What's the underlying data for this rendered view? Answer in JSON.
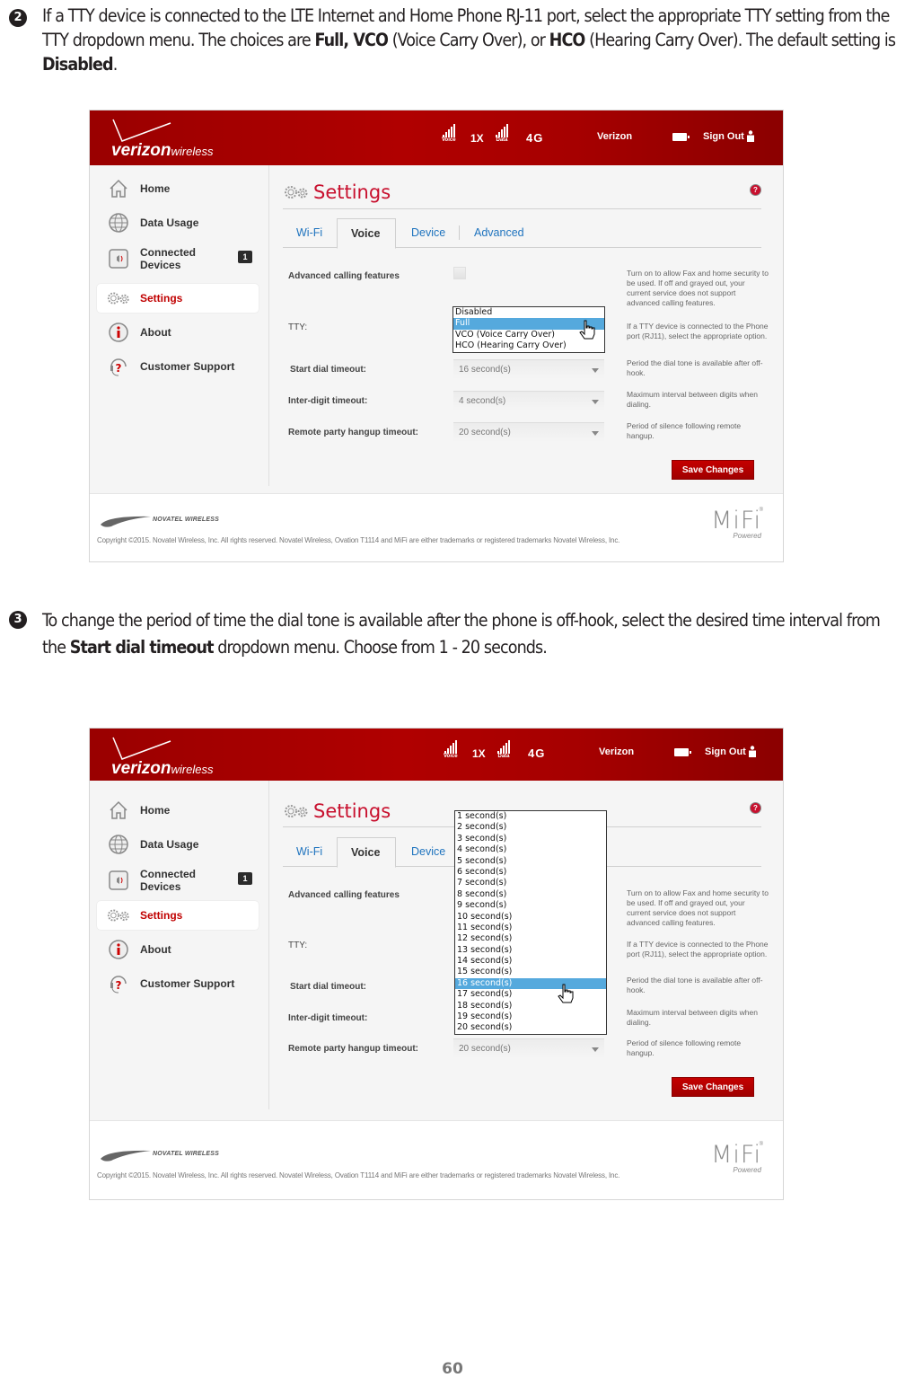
{
  "steps": [
    {
      "number": "2",
      "text_parts": {
        "p1": "If a TTY device is connected to the LTE Internet and Home Phone RJ-11 port, select the appropriate TTY setting from the TTY dropdown menu. The choices are ",
        "b1": "Full, VCO",
        "p2": " (Voice Carry Over), or ",
        "b2": "HCO",
        "p3": " (Hearing Carry Over). The default setting is ",
        "b3": "Disabled",
        "p4": "."
      }
    },
    {
      "number": "3",
      "text_parts": {
        "p1": "To change the period of time the dial tone is available after the phone is off-hook, select the desired time interval from the ",
        "b1": "Start dial timeout",
        "p2": " dropdown menu. Choose from 1 - 20 seconds."
      }
    }
  ],
  "app": {
    "brand_bold": "verizon",
    "brand_light": "wireless",
    "status": {
      "voice_label": "Voice",
      "network_1x": "1X",
      "data_label": "Data",
      "network_4g": "4G",
      "carrier": "Verizon",
      "sign_out": "Sign Out"
    },
    "sidebar": [
      {
        "label": "Home",
        "icon": "home-icon"
      },
      {
        "label": "Data Usage",
        "icon": "globe-icon"
      },
      {
        "label": "Connected Devices",
        "icon": "speaker-icon",
        "badge": "1"
      },
      {
        "label": "Settings",
        "icon": "gears-icon",
        "active": true
      },
      {
        "label": "About",
        "icon": "info-icon"
      },
      {
        "label": "Customer Support",
        "icon": "support-icon"
      }
    ],
    "page_title": "Settings",
    "tabs": [
      "Wi-Fi",
      "Voice",
      "Device",
      "Advanced"
    ],
    "active_tab": "Voice",
    "rows": {
      "advanced_calling": {
        "label": "Advanced calling features",
        "desc": "Turn on to allow Fax and home security to be used. If off and grayed out, your current service does not support advanced calling features."
      },
      "tty": {
        "label": "TTY:",
        "desc": "If a TTY device is connected to the Phone port (RJ11), select the appropriate option."
      },
      "start_dial": {
        "label": "Start dial timeout:",
        "value": "16 second(s)",
        "desc": "Period the dial tone is available after off-hook."
      },
      "inter_digit": {
        "label": "Inter-digit timeout:",
        "value": "4 second(s)",
        "desc": "Maximum interval between digits when dialing."
      },
      "remote_hangup": {
        "label": "Remote party hangup timeout:",
        "value": "20 second(s)",
        "desc": "Period of silence following remote hangup."
      }
    },
    "save_label": "Save Changes",
    "footer": {
      "novatel": "NOVATEL WIRELESS",
      "copyright": "Copyright ©2015. Novatel Wireless, Inc. All rights reserved. Novatel Wireless, Ovation T1114 and MiFi are either trademarks or registered trademarks Novatel Wireless, Inc.",
      "mifi": "MiFi",
      "mifi_reg": "®",
      "powered": "Powered"
    }
  },
  "tty_dropdown": {
    "options": [
      "Disabled",
      "Full",
      "VCO (Voice Carry Over)",
      "HCO (Hearing Carry Over)"
    ],
    "highlighted": "Full"
  },
  "start_dial_dropdown": {
    "options": [
      "1 second(s)",
      "2 second(s)",
      "3 second(s)",
      "4 second(s)",
      "5 second(s)",
      "6 second(s)",
      "7 second(s)",
      "8 second(s)",
      "9 second(s)",
      "10 second(s)",
      "11 second(s)",
      "12 second(s)",
      "13 second(s)",
      "14 second(s)",
      "15 second(s)",
      "16 second(s)",
      "17 second(s)",
      "18 second(s)",
      "19 second(s)",
      "20 second(s)"
    ],
    "highlighted": "16 second(s)"
  },
  "page_number": "60"
}
